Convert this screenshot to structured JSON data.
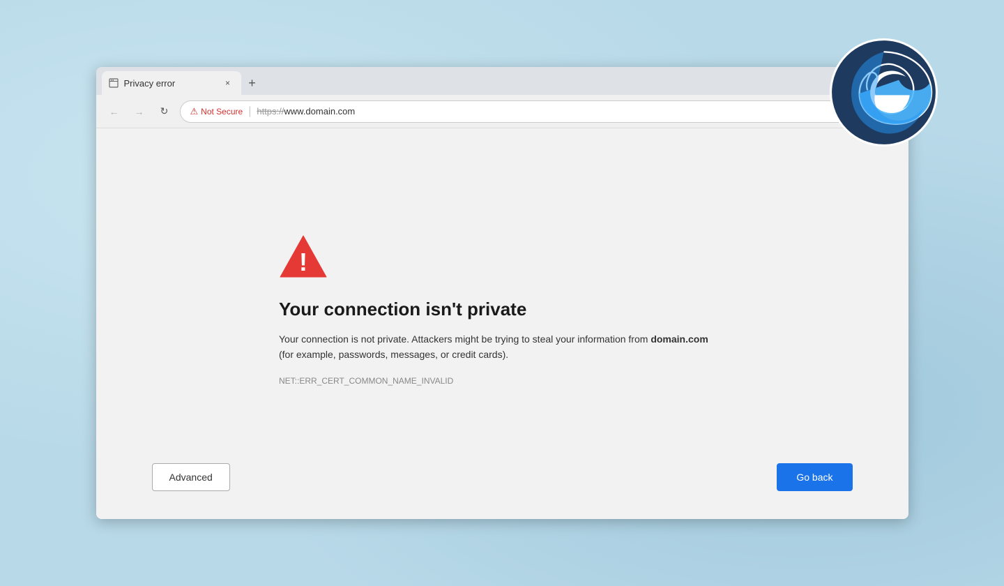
{
  "browser": {
    "tab": {
      "title": "Privacy error",
      "close_label": "×",
      "new_tab_label": "+"
    },
    "nav": {
      "back_label": "←",
      "forward_label": "→",
      "reload_label": "↻"
    },
    "address_bar": {
      "not_secure_label": "Not Secure",
      "separator": "|",
      "url_https": "https://",
      "url_domain": "www.domain.com"
    },
    "actions": {
      "favorite_label": "☆",
      "collections_label": "⊕"
    }
  },
  "error_page": {
    "title": "Your connection isn't private",
    "description_prefix": "Your connection is not private. Attackers might be trying to steal your information from ",
    "domain_bold": "domain.com",
    "description_suffix": " (for example, passwords, messages, or credit cards).",
    "error_code": "NET::ERR_CERT_COMMON_NAME_INVALID"
  },
  "buttons": {
    "advanced_label": "Advanced",
    "go_back_label": "Go back"
  }
}
